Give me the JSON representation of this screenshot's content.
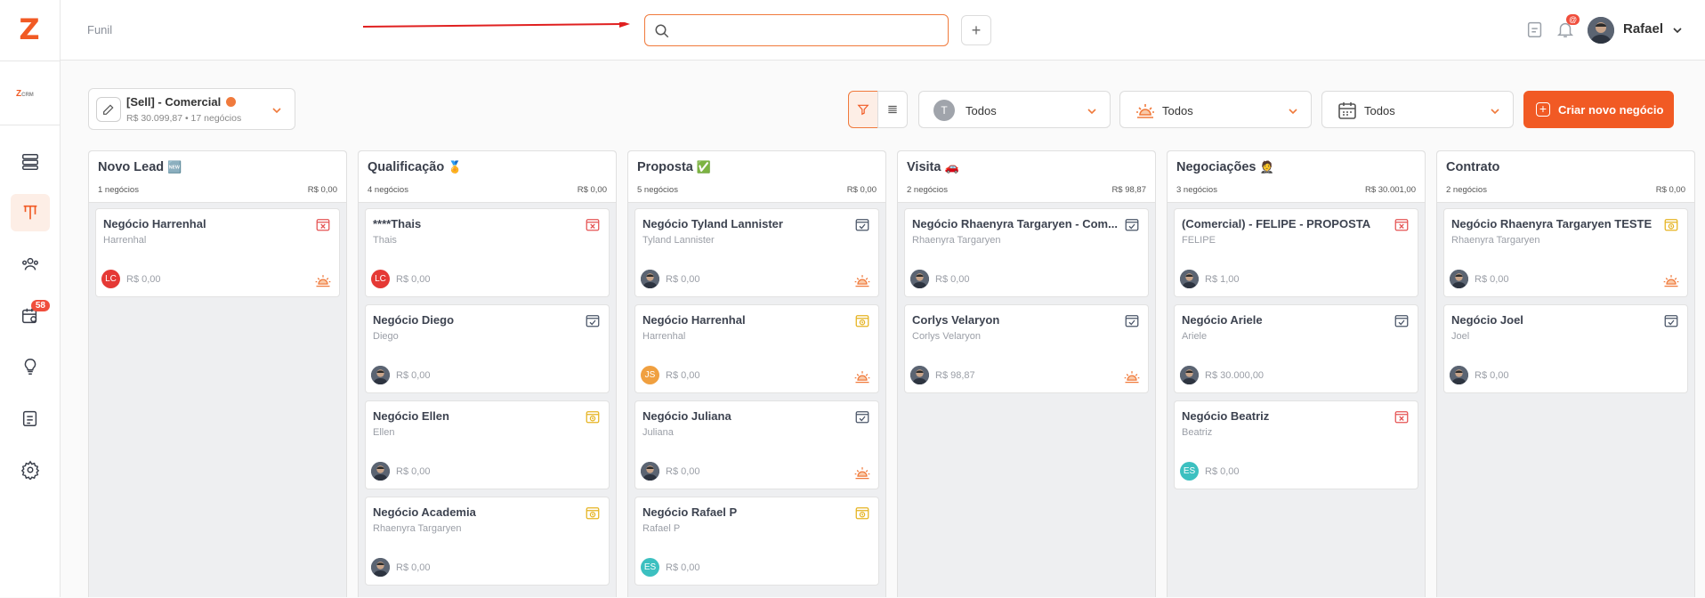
{
  "app": {
    "logo_letter": "Z",
    "crm_label": "CRM"
  },
  "breadcrumb": "Funil",
  "search": {
    "placeholder": ""
  },
  "user": {
    "name": "Rafael",
    "notifications_badge": "@"
  },
  "sidebar": {
    "agenda_badge": "58"
  },
  "pipeline": {
    "name": "[Sell] - Comercial",
    "summary": "R$ 30.099,87 • 17 negócios"
  },
  "filters": {
    "user_filter": "Todos",
    "user_filter_initial": "T",
    "temperature_filter": "Todos",
    "date_filter": "Todos"
  },
  "create_button": "Criar novo negócio",
  "colors": {
    "accent": "#f15a24",
    "lost": "#e55353",
    "won": "#4a5568",
    "pending": "#e6b422"
  },
  "columns": [
    {
      "title": "Novo Lead",
      "emoji": "🆕",
      "count": "1 negócios",
      "total": "R$ 0,00",
      "cards": [
        {
          "title": "Negócio Harrenhal",
          "subtitle": "Harrenhal",
          "value": "R$ 0,00",
          "status": "lost",
          "avatar": "LC",
          "avatar_color": "#e53935",
          "hot": true
        }
      ]
    },
    {
      "title": "Qualificação",
      "emoji": "🏅",
      "count": "4 negócios",
      "total": "R$ 0,00",
      "cards": [
        {
          "title": "****Thais",
          "subtitle": "Thais",
          "value": "R$ 0,00",
          "status": "lost",
          "avatar": "LC",
          "avatar_color": "#e53935",
          "hot": false
        },
        {
          "title": "Negócio Diego",
          "subtitle": "Diego",
          "value": "R$ 0,00",
          "status": "done",
          "avatar": "",
          "avatar_color": "#4a5568",
          "hot": false
        },
        {
          "title": "Negócio Ellen",
          "subtitle": "Ellen",
          "value": "R$ 0,00",
          "status": "pending",
          "avatar": "",
          "avatar_color": "#4a5568",
          "hot": false
        },
        {
          "title": "Negócio Academia",
          "subtitle": "Rhaenyra Targaryen",
          "value": "R$ 0,00",
          "status": "pending",
          "avatar": "",
          "avatar_color": "#4a5568",
          "hot": false
        }
      ]
    },
    {
      "title": "Proposta",
      "emoji": "✅",
      "count": "5 negócios",
      "total": "R$ 0,00",
      "cards": [
        {
          "title": "Negócio Tyland Lannister",
          "subtitle": "Tyland Lannister",
          "value": "R$ 0,00",
          "status": "done",
          "avatar": "",
          "avatar_color": "#4a5568",
          "hot": true
        },
        {
          "title": "Negócio Harrenhal",
          "subtitle": "Harrenhal",
          "value": "R$ 0,00",
          "status": "pending",
          "avatar": "JS",
          "avatar_color": "#f0a040",
          "hot": true
        },
        {
          "title": "Negócio Juliana",
          "subtitle": "Juliana",
          "value": "R$ 0,00",
          "status": "done",
          "avatar": "",
          "avatar_color": "#4a5568",
          "hot": true
        },
        {
          "title": "Negócio Rafael P",
          "subtitle": "Rafael P",
          "value": "R$ 0,00",
          "status": "pending",
          "avatar": "ES",
          "avatar_color": "#3cc0c0",
          "hot": false
        }
      ]
    },
    {
      "title": "Visita",
      "emoji": "🚗",
      "count": "2 negócios",
      "total": "R$ 98,87",
      "cards": [
        {
          "title": "Negócio Rhaenyra Targaryen - Com...",
          "subtitle": "Rhaenyra Targaryen",
          "value": "R$ 0,00",
          "status": "done",
          "avatar": "",
          "avatar_color": "#4a5568",
          "hot": false
        },
        {
          "title": "Corlys Velaryon",
          "subtitle": "Corlys Velaryon",
          "value": "R$ 98,87",
          "status": "done",
          "avatar": "",
          "avatar_color": "#4a5568",
          "hot": true
        }
      ]
    },
    {
      "title": "Negociações",
      "emoji": "🤵",
      "count": "3 negócios",
      "total": "R$ 30.001,00",
      "cards": [
        {
          "title": "(Comercial) - FELIPE - PROPOSTA",
          "subtitle": "FELIPE",
          "value": "R$ 1,00",
          "status": "lost",
          "avatar": "",
          "avatar_color": "#4a5568",
          "hot": false
        },
        {
          "title": "Negócio Ariele",
          "subtitle": "Ariele",
          "value": "R$ 30.000,00",
          "status": "done",
          "avatar": "",
          "avatar_color": "#4a5568",
          "hot": false
        },
        {
          "title": "Negócio Beatriz",
          "subtitle": "Beatriz",
          "value": "R$ 0,00",
          "status": "lost",
          "avatar": "ES",
          "avatar_color": "#3cc0c0",
          "hot": false
        }
      ]
    },
    {
      "title": "Contrato",
      "emoji": "",
      "count": "2 negócios",
      "total": "R$ 0,00",
      "cards": [
        {
          "title": "Negócio Rhaenyra Targaryen TESTE",
          "subtitle": "Rhaenyra Targaryen",
          "value": "R$ 0,00",
          "status": "pending",
          "avatar": "",
          "avatar_color": "#4a5568",
          "hot": true
        },
        {
          "title": "Negócio Joel",
          "subtitle": "Joel",
          "value": "R$ 0,00",
          "status": "done",
          "avatar": "",
          "avatar_color": "#4a5568",
          "hot": false
        }
      ]
    }
  ]
}
